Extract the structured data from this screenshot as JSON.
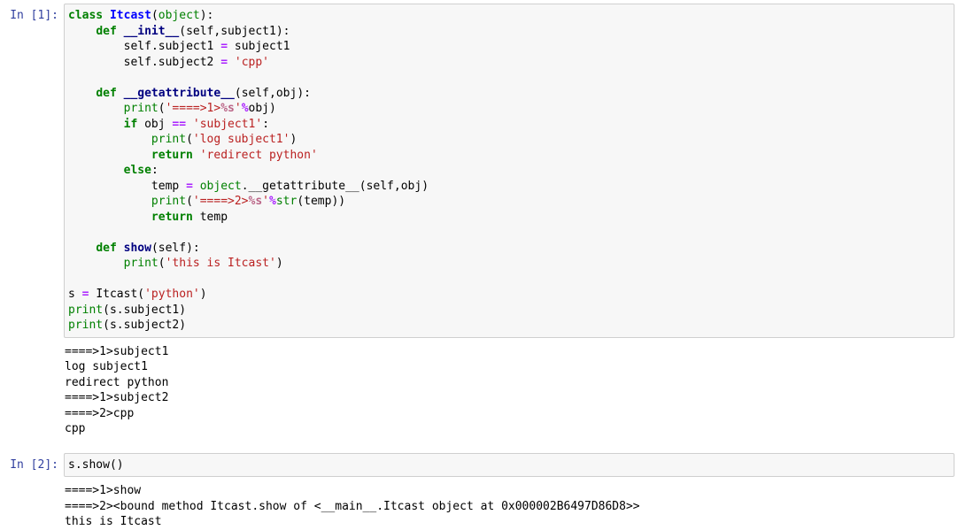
{
  "notebook": {
    "kernel_language": "python",
    "cells": [
      {
        "type": "code",
        "prompt": "In [1]:",
        "source_lines": [
          "class Itcast(object):",
          "    def __init__(self,subject1):",
          "        self.subject1 = subject1",
          "        self.subject2 = 'cpp'",
          "",
          "    def __getattribute__(self,obj):",
          "        print('====>1>%s'%obj)",
          "        if obj == 'subject1':",
          "            print('log subject1')",
          "            return 'redirect python'",
          "        else:",
          "            temp = object.__getattribute__(self,obj)",
          "            print('====>2>%s'%str(temp))",
          "            return temp",
          "",
          "    def show(self):",
          "        print('this is Itcast')",
          "",
          "s = Itcast('python')",
          "print(s.subject1)",
          "print(s.subject2)"
        ],
        "output_prompt": "",
        "output_lines": [
          "====>1>subject1",
          "log subject1",
          "redirect python",
          "====>1>subject2",
          "====>2>cpp",
          "cpp"
        ]
      },
      {
        "type": "code",
        "prompt": "In [2]:",
        "source_lines": [
          "s.show()"
        ],
        "output_prompt": "",
        "output_lines": [
          "====>1>show",
          "====>2><bound method Itcast.show of <__main__.Itcast object at 0x000002B6497D86D8>>",
          "this is Itcast"
        ]
      }
    ]
  },
  "colors": {
    "cell_background": "#f7f7f7",
    "cell_border": "#cfcfcf",
    "prompt_in": "#303F9F",
    "keyword": "#008000",
    "string": "#BA2121",
    "operator": "#AA22FF",
    "function_name": "#000080",
    "class_name": "#0000FF",
    "builtin": "#008000",
    "string_interp": "#BB6688",
    "output_text": "#000000",
    "page_background": "#ffffff"
  }
}
